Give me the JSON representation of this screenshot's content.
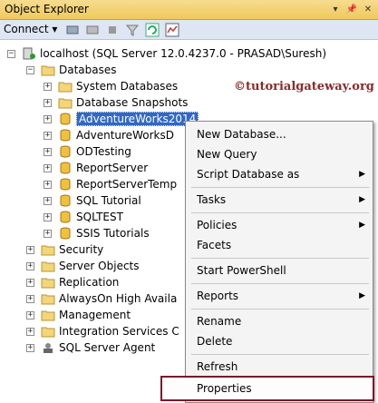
{
  "window": {
    "title": "Object Explorer"
  },
  "toolbar": {
    "connect_label": "Connect ▾"
  },
  "watermark": "©tutorialgateway.org",
  "tree": {
    "server": "localhost (SQL Server 12.0.4237.0 - PRASAD\\Suresh)",
    "databases": "Databases",
    "system_databases": "System Databases",
    "snapshots": "Database Snapshots",
    "dbs": [
      "AdventureWorks2014",
      "AdventureWorksD",
      "ODTesting",
      "ReportServer",
      "ReportServerTemp",
      "SQL Tutorial",
      "SQLTEST",
      "SSIS Tutorials"
    ],
    "others": [
      "Security",
      "Server Objects",
      "Replication",
      "AlwaysOn High Availa",
      "Management",
      "Integration Services C"
    ],
    "agent": "SQL Server Agent"
  },
  "menu": {
    "new_database": "New Database...",
    "new_query": "New Query",
    "script_as": "Script Database as",
    "tasks": "Tasks",
    "policies": "Policies",
    "facets": "Facets",
    "powershell": "Start PowerShell",
    "reports": "Reports",
    "rename": "Rename",
    "delete": "Delete",
    "refresh": "Refresh",
    "properties": "Properties"
  },
  "colors": {
    "selection": "#3168c5",
    "highlight_border": "#7a1a2a",
    "titlebar": "#f0c95b"
  }
}
